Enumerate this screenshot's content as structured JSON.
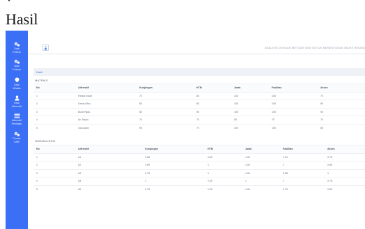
{
  "caption": {
    "title": "Hasil"
  },
  "sidebar": {
    "items": [
      {
        "label_lines": [
          "Data",
          "Kriteria"
        ],
        "icon": "gears-icon"
      },
      {
        "label_lines": [
          "Nilai",
          "Kriteria"
        ],
        "icon": "gears-icon"
      },
      {
        "label_lines": [
          "Data",
          "Wisata"
        ],
        "icon": "map-pin-icon"
      },
      {
        "label_lines": [
          "Data",
          "Alternatif"
        ],
        "icon": "user-icon"
      },
      {
        "label_lines": [
          "Alternatif",
          "Penilaian"
        ],
        "icon": "list-icon"
      },
      {
        "label_lines": [
          "Proses",
          "SAW"
        ],
        "icon": "gears-icon"
      }
    ]
  },
  "topbar": {
    "right_text": "ANALISIS DENGAN METODE SAW UNTUK MENENTUKAN OBJEK WISATA"
  },
  "breadcrumb": "Hasil",
  "matrix": {
    "title": "MATRIKS",
    "headers": [
      "No",
      "Alternatif",
      "Kunjungan",
      "HTM",
      "Jarak",
      "Fasilitas",
      "Akses"
    ],
    "rows": [
      [
        "1",
        "Pantai Indah",
        "70",
        "80",
        "100",
        "100",
        "70"
      ],
      [
        "2",
        "Danau Biru",
        "80",
        "80",
        "100",
        "100",
        "80"
      ],
      [
        "3",
        "Bukit Hijau",
        "80",
        "90",
        "100",
        "100",
        "90"
      ],
      [
        "4",
        "Air Terjun",
        "70",
        "70",
        "50",
        "75",
        "70"
      ],
      [
        "5",
        "Goa Alam",
        "90",
        "70",
        "100",
        "100",
        "80"
      ]
    ]
  },
  "normalisasi": {
    "title": "NORMALISASI",
    "headers": [
      "No",
      "Alternatif",
      "Kunjungan",
      "HTM",
      "Jarak",
      "Fasilitas",
      "Akses"
    ],
    "rows": [
      [
        "1",
        "A1",
        "0.88",
        "0.89",
        "1.00",
        "1.00",
        "0.78"
      ],
      [
        "2",
        "A2",
        "0.89",
        "1",
        "1.00",
        "1",
        "0.89"
      ],
      [
        "3",
        "A3",
        "0.78",
        "1",
        "1.00",
        "0.88",
        "1"
      ],
      [
        "4",
        "A4",
        "1",
        "1.00",
        "1",
        "1",
        "0.78"
      ],
      [
        "5",
        "A5",
        "0.78",
        "1.00",
        "1.00",
        "0.75",
        "0.89"
      ]
    ]
  }
}
